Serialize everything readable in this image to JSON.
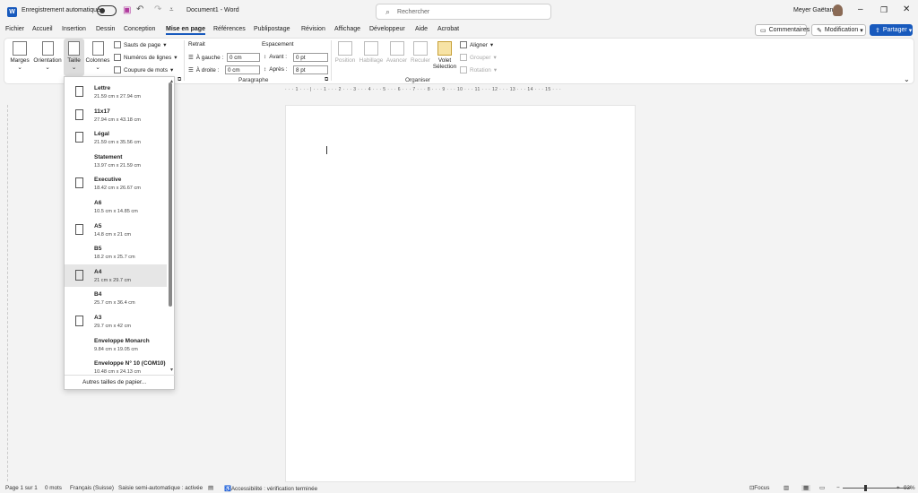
{
  "titlebar": {
    "autosave_label": "Enregistrement automatique",
    "doc_title": "Document1 - Word",
    "search_placeholder": "Rechercher",
    "user_name": "Meyer Gaëtan",
    "app_letter": "W"
  },
  "menu": {
    "items": [
      "Fichier",
      "Accueil",
      "Insertion",
      "Dessin",
      "Conception",
      "Mise en page",
      "Références",
      "Publipostage",
      "Révision",
      "Affichage",
      "Développeur",
      "Aide",
      "Acrobat"
    ],
    "active": "Mise en page",
    "comments": "Commentaires",
    "edit_mode": "Modification",
    "share": "Partager"
  },
  "ribbon": {
    "margins": "Marges",
    "orientation": "Orientation",
    "size": "Taille",
    "columns": "Colonnes",
    "breaks": "Sauts de page",
    "line_numbers": "Numéros de lignes",
    "hyphenation": "Coupure de mots",
    "indent_title": "Retrait",
    "spacing_title": "Espacement",
    "indent_left_label": "À gauche :",
    "indent_left_value": "0 cm",
    "indent_right_label": "À droite :",
    "indent_right_value": "0 cm",
    "spacing_before_label": "Avant :",
    "spacing_before_value": "0 pt",
    "spacing_after_label": "Après :",
    "spacing_after_value": "8 pt",
    "group_paragraph": "Paragraphe",
    "group_arrange": "Organiser",
    "position": "Position",
    "wrap": "Habillage",
    "forward": "Avancer",
    "backward": "Reculer",
    "selection_pane_1": "Volet",
    "selection_pane_2": "Sélection",
    "align": "Aligner",
    "group": "Grouper",
    "rotate": "Rotation"
  },
  "ruler": {
    "marks": "· · · 1 · · · | · · · 1 · · · 2 · · · 3 · · · 4 · · · 5 · · · 6 · · · 7 · · · 8 · · · 9 · · · 10 · · · 11 · · · 12 · · · 13 · · · 14 · · · 15 · · ·"
  },
  "size_menu": {
    "items": [
      {
        "name": "Lettre",
        "dims": "21.59 cm x 27.94 cm",
        "thumb": true
      },
      {
        "name": "11x17",
        "dims": "27.94 cm x 43.18 cm",
        "thumb": true
      },
      {
        "name": "Légal",
        "dims": "21.59 cm x 35.56 cm",
        "thumb": true
      },
      {
        "name": "Statement",
        "dims": "13.97 cm x 21.59 cm",
        "thumb": false
      },
      {
        "name": "Executive",
        "dims": "18.42 cm x 26.67 cm",
        "thumb": true
      },
      {
        "name": "A6",
        "dims": "10.5 cm x 14.85 cm",
        "thumb": false
      },
      {
        "name": "A5",
        "dims": "14.8 cm x 21 cm",
        "thumb": true
      },
      {
        "name": "B5",
        "dims": "18.2 cm x 25.7 cm",
        "thumb": false
      },
      {
        "name": "A4",
        "dims": "21 cm x 29.7 cm",
        "thumb": true,
        "selected": true
      },
      {
        "name": "B4",
        "dims": "25.7 cm x 36.4 cm",
        "thumb": false
      },
      {
        "name": "A3",
        "dims": "29.7 cm x 42 cm",
        "thumb": true
      },
      {
        "name": "Enveloppe Monarch",
        "dims": "9.84 cm x 19.05 cm",
        "thumb": false
      },
      {
        "name": "Enveloppe N° 10 (COM10)",
        "dims": "10.48 cm x 24.13 cm",
        "thumb": false
      }
    ],
    "footer": "Autres tailles de papier..."
  },
  "status": {
    "page": "Page 1 sur 1",
    "words": "0 mots",
    "language": "Français (Suisse)",
    "autocomplete": "Saisie semi-automatique : activée",
    "accessibility": "Accessibilité : vérification terminée",
    "focus": "Focus",
    "zoom": "93%"
  }
}
